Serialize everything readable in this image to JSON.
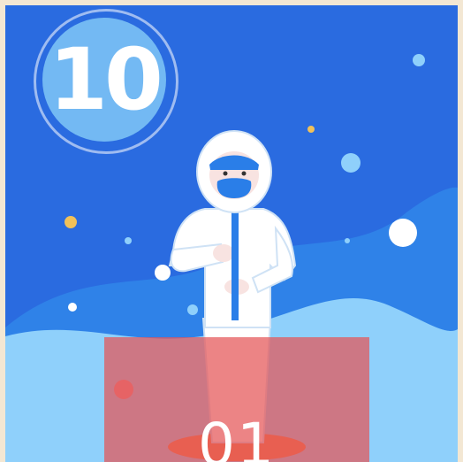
{
  "badge": {
    "number": "10"
  },
  "step": {
    "number": "01"
  },
  "colors": {
    "sky": "#2a6be0",
    "wave_dark": "#2f82e8",
    "wave_light": "#8fd0fb",
    "badge_fill": "#73b9f3",
    "overlay": "#e55456",
    "accent_dot": "#f1c15a"
  },
  "icons": {
    "figure": "medical-worker-in-protective-suit-illustration",
    "badge": "number-circle-badge"
  }
}
